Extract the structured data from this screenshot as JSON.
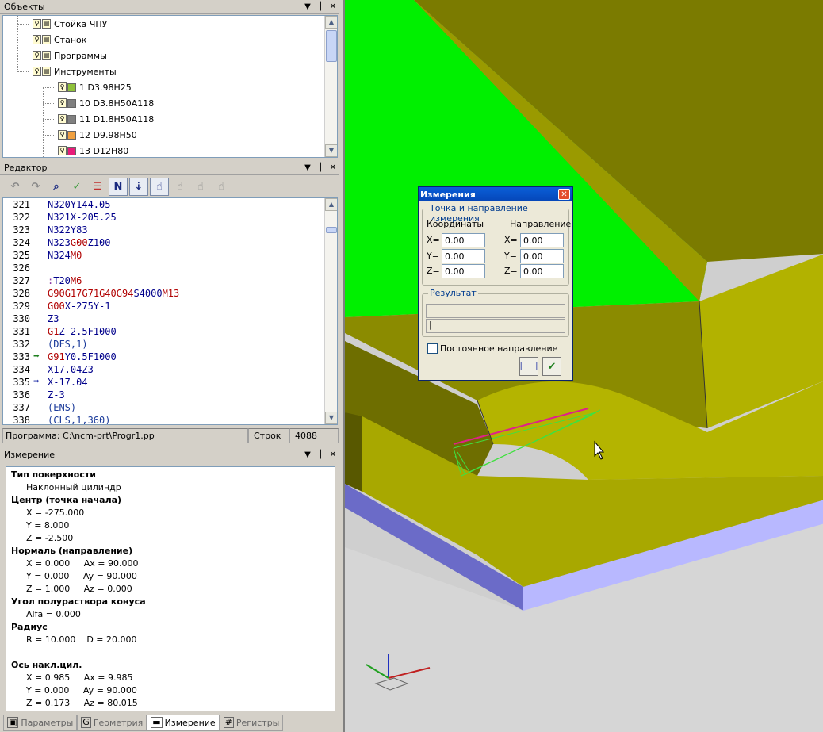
{
  "objects_panel": {
    "title": "Объекты",
    "items": [
      {
        "label": "Стойка ЧПУ",
        "icon": "cnc-rack-icon",
        "indent": 2
      },
      {
        "label": "Станок",
        "icon": "machine-icon",
        "indent": 2
      },
      {
        "label": "Программы",
        "icon": "programs-icon",
        "indent": 2,
        "expander": "+"
      },
      {
        "label": "Инструменты",
        "icon": "tools-icon",
        "indent": 2,
        "expander": "-"
      },
      {
        "label": "1 D3.98H25",
        "color": "#8fc13a",
        "indent": 3
      },
      {
        "label": "10 D3.8H50A118",
        "color": "#808080",
        "indent": 3
      },
      {
        "label": "11 D1.8H50A118",
        "color": "#808080",
        "indent": 3
      },
      {
        "label": "12 D9.98H50",
        "color": "#f0a040",
        "indent": 3
      },
      {
        "label": "13 D12H80",
        "color": "#e81c7a",
        "indent": 3
      }
    ]
  },
  "editor_panel": {
    "title": "Редактор",
    "lines": [
      {
        "n": "321",
        "text": "N320Y144.05"
      },
      {
        "n": "322",
        "text": "N321X-205.25"
      },
      {
        "n": "323",
        "text": "N322Y83"
      },
      {
        "n": "324",
        "text": "N323G00Z100"
      },
      {
        "n": "325",
        "text": "N324M0"
      },
      {
        "n": "326",
        "text": ""
      },
      {
        "n": "327",
        "text": ":T20M6"
      },
      {
        "n": "328",
        "text": "G90G17G71G40G94S4000M13"
      },
      {
        "n": "329",
        "text": "G00X-275Y-1"
      },
      {
        "n": "330",
        "text": "Z3"
      },
      {
        "n": "331",
        "text": "G1Z-2.5F1000"
      },
      {
        "n": "332",
        "text": "(DFS,1)"
      },
      {
        "n": "333",
        "text": "G91Y0.5F1000",
        "marker": "green"
      },
      {
        "n": "334",
        "text": "X17.04Z3"
      },
      {
        "n": "335",
        "text": "X-17.04",
        "marker": "blue"
      },
      {
        "n": "336",
        "text": "Z-3"
      },
      {
        "n": "337",
        "text": "(ENS)"
      },
      {
        "n": "338",
        "text": "(CLS,1,360)"
      }
    ]
  },
  "status": {
    "program": "Программа: C:\\ncm-prt\\Progr1.pp",
    "lines_label": "Строк",
    "lines_count": "4088"
  },
  "measure_panel": {
    "title": "Измерение",
    "rows": [
      {
        "text": "Тип поверхности",
        "h": true
      },
      {
        "text": "Наклонный цилиндр"
      },
      {
        "text": "Центр (точка начала)",
        "h": true
      },
      {
        "text": "X = -275.000"
      },
      {
        "text": "Y = 8.000"
      },
      {
        "text": "Z = -2.500"
      },
      {
        "text": "Нормаль (направление)",
        "h": true
      },
      {
        "text": "X = 0.000     Ax = 90.000"
      },
      {
        "text": "Y = 0.000     Ay = 90.000"
      },
      {
        "text": "Z = 1.000     Az = 0.000"
      },
      {
        "text": "Угол полураствора конуса",
        "h": true
      },
      {
        "text": "Alfa = 0.000"
      },
      {
        "text": "Радиус",
        "h": true
      },
      {
        "text": "R = 10.000    D = 20.000"
      },
      {
        "text": ""
      },
      {
        "text": "Ось накл.цил.",
        "h": true
      },
      {
        "text": "X = 0.985     Ax = 9.985"
      },
      {
        "text": "Y = 0.000     Ay = 90.000"
      },
      {
        "text": "Z = 0.173     Az = 80.015"
      }
    ]
  },
  "tabs": [
    {
      "label": "Параметры",
      "icon": "▣"
    },
    {
      "label": "Геометрия",
      "icon": "G"
    },
    {
      "label": "Измерение",
      "icon": "▬",
      "active": true
    },
    {
      "label": "Регистры",
      "icon": "#"
    }
  ],
  "dialog": {
    "title": "Измерения",
    "group1": "Точка и направление измерения",
    "coords": "Координаты",
    "direction": "Направление",
    "x": "X=",
    "y": "Y=",
    "z": "Z=",
    "cx": "0.00",
    "cy": "0.00",
    "cz": "0.00",
    "dx": "0.00",
    "dy": "0.00",
    "dz": "0.00",
    "result": "Результат",
    "result_value": "|",
    "checkbox": "Постоянное направление"
  }
}
